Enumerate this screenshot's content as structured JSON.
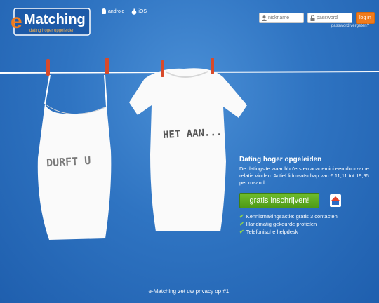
{
  "brand": {
    "logo_letter": "e",
    "logo_text": "Matching",
    "logo_tagline": "dating hoger opgeleiden"
  },
  "platforms": [
    {
      "icon": "android-icon",
      "label": "android"
    },
    {
      "icon": "apple-icon",
      "label": "iOS"
    }
  ],
  "login": {
    "nickname_placeholder": "nickname",
    "password_placeholder": "password",
    "submit_label": "log in",
    "forgot_label": "password vergeten?"
  },
  "shirts": {
    "left_text": "DURFT U",
    "right_text": "HET AAN..."
  },
  "hero": {
    "headline": "Dating hoger opgeleiden",
    "description": "De datingsite waar hbo'ers en academici een duurzame relatie vinden. Actief lidmaatschap van € 11,11 tot 19,95 per maand.",
    "cta_label": "gratis inschrijven!"
  },
  "features": [
    "Kennismakingsactie: gratis 3 contacten",
    "Handmatig gekeurde profielen",
    "Telefonische helpdesk"
  ],
  "footer": {
    "text": "e-Matching zet uw privacy op #1!"
  },
  "colors": {
    "background": "#2f74c2",
    "logo_orange": "#f07b1d",
    "logo_blue": "#1d5aa8",
    "cta_green": "#5aa51d",
    "peg_red": "#d84a2a"
  }
}
